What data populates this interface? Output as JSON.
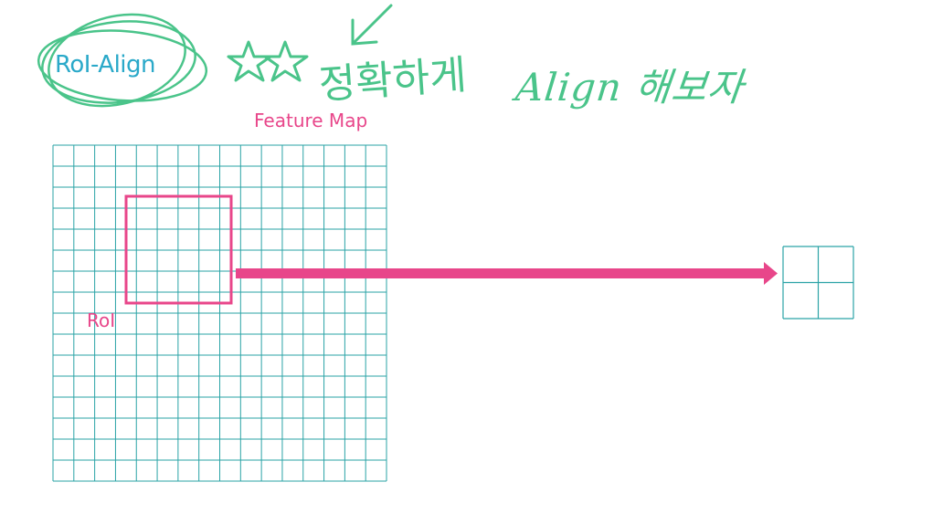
{
  "title": "RoI-Align",
  "feature_map_label": "Feature Map",
  "roi_label": "RoI",
  "handwritten_note_stars": "★★",
  "handwritten_note_korean": "정확하게",
  "handwritten_note": "Align 해보자",
  "feature_map_grid": {
    "rows": 16,
    "cols": 16
  },
  "output_grid": {
    "rows": 2,
    "cols": 2
  },
  "colors": {
    "title": "#2aa9c9",
    "ink_green": "#4ac48a",
    "grid": "#2aa3a6",
    "accent_pink": "#e8468a"
  }
}
